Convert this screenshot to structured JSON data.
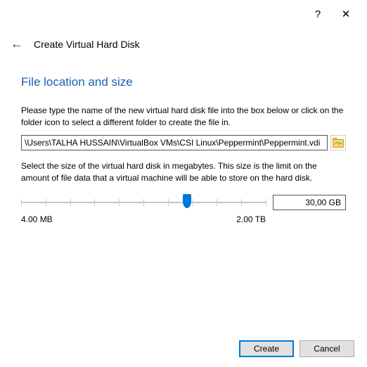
{
  "titlebar": {
    "help_icon": "?",
    "close_icon": "✕"
  },
  "header": {
    "back_icon": "←",
    "title": "Create Virtual Hard Disk"
  },
  "section": {
    "heading": "File location and size",
    "file_instruction": "Please type the name of the new virtual hard disk file into the box below or click on the folder icon to select a different folder to create the file in.",
    "file_path": "\\Users\\TALHA HUSSAIN\\VirtualBox VMs\\CSI Linux\\Peppermint\\Peppermint.vdi",
    "size_instruction": "Select the size of the virtual hard disk in megabytes. This size is the limit on the amount of file data that a virtual machine will be able to store on the hard disk.",
    "size_value": "30,00 GB",
    "scale_min": "4.00 MB",
    "scale_max": "2.00 TB"
  },
  "footer": {
    "create": "Create",
    "cancel": "Cancel"
  }
}
